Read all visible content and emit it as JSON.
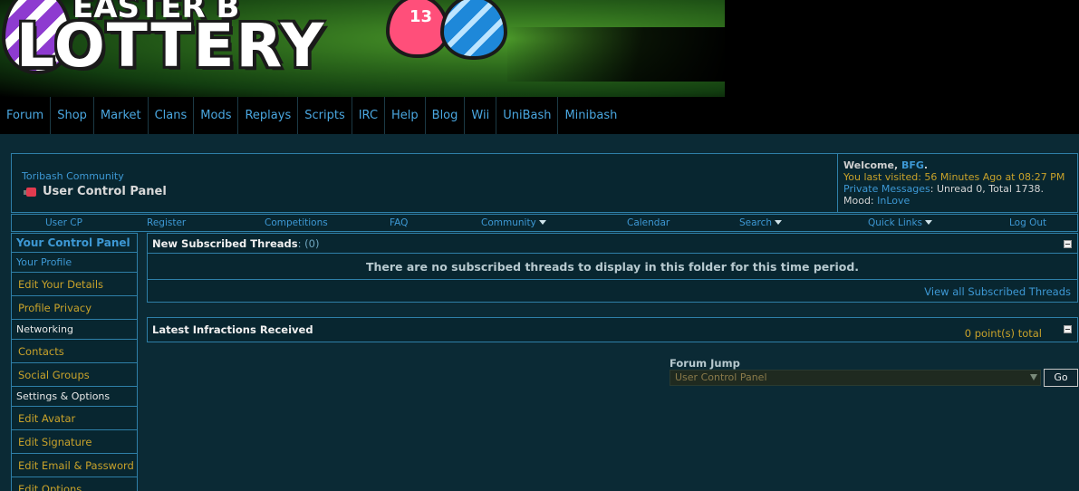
{
  "banner": {
    "logo_top": "EASTER B",
    "logo_main": "LOTTERY",
    "egg_number": "13"
  },
  "nav": [
    "Forum",
    "Shop",
    "Market",
    "Clans",
    "Mods",
    "Replays",
    "Scripts",
    "IRC",
    "Help",
    "Blog",
    "Wii",
    "UniBash",
    "Minibash"
  ],
  "header": {
    "breadcrumb": "Toribash Community",
    "page_title": "User Control Panel",
    "welcome_prefix": "Welcome, ",
    "username": "BFG",
    "welcome_suffix": ".",
    "last_visited": "You last visited: 56 Minutes Ago at 08:27 PM",
    "pm_label": "Private Messages",
    "pm_value": ": Unread 0, Total 1738.",
    "mood_label": "Mood: ",
    "mood_value": "InLove"
  },
  "subnav": [
    "User CP",
    "Register",
    "Competitions",
    "FAQ",
    "Community",
    "Calendar",
    "Search",
    "Quick Links",
    "Log Out"
  ],
  "sidebar": {
    "head": "Your Control Panel",
    "profile": "Your Profile",
    "profile_links": [
      "Edit Your Details",
      "Profile Privacy"
    ],
    "networking": "Networking",
    "networking_links": [
      "Contacts",
      "Social Groups"
    ],
    "settings": "Settings & Options",
    "settings_links": [
      "Edit Avatar",
      "Edit Signature",
      "Edit Email & Password",
      "Edit Options"
    ]
  },
  "subscribed": {
    "title": "New Subscribed Threads",
    "count": ": (0)",
    "empty_message": "There are no subscribed threads to display in this folder for this time period.",
    "view_all": "View all Subscribed Threads"
  },
  "infractions": {
    "title": "Latest Infractions Received",
    "points": "0 point(s) total"
  },
  "forum_jump": {
    "label": "Forum Jump",
    "selected": "User Control Panel",
    "go": "Go"
  },
  "colors": {
    "background": "#0b2a35",
    "link": "#3d98d4",
    "accent_gold": "#c8a22a",
    "border": "#2e7fa8"
  }
}
